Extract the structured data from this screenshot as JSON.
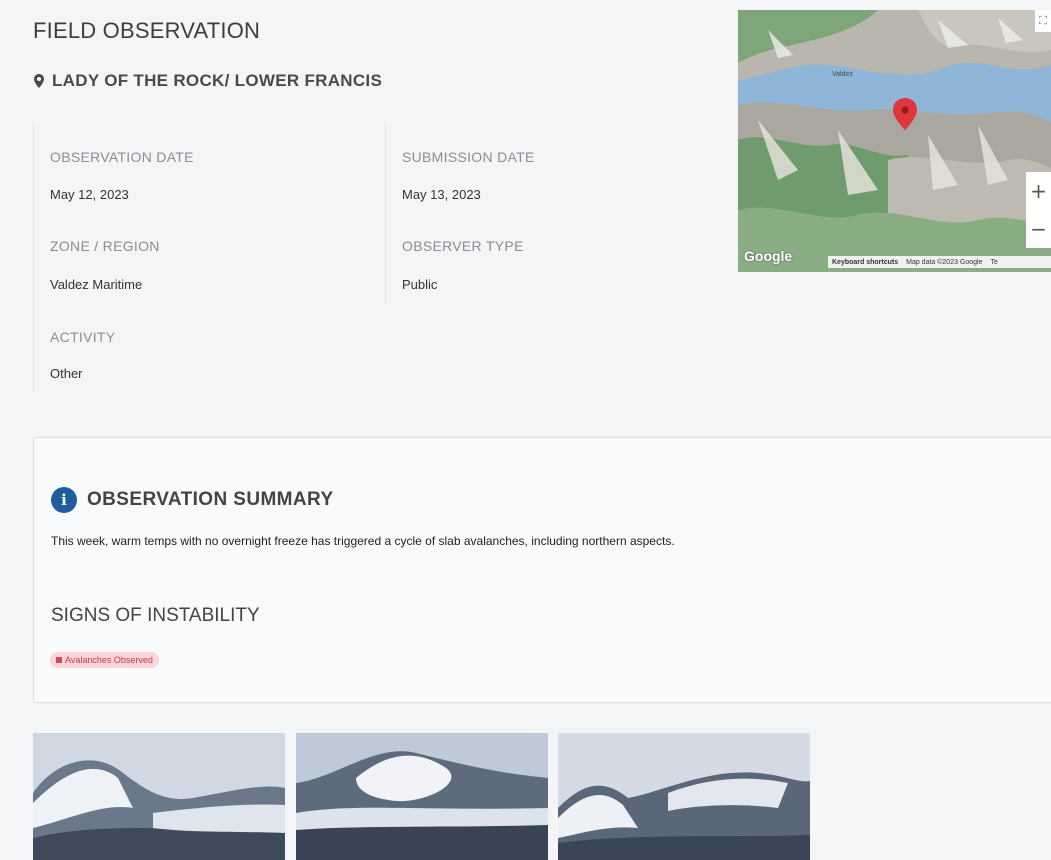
{
  "header": {
    "title": "FIELD OBSERVATION",
    "location": "LADY OF THE ROCK/ LOWER FRANCIS"
  },
  "details": {
    "observation_date": {
      "label": "OBSERVATION DATE",
      "value": "May 12, 2023"
    },
    "submission_date": {
      "label": "SUBMISSION DATE",
      "value": "May 13, 2023"
    },
    "zone": {
      "label": "ZONE / REGION",
      "value": "Valdez Maritime"
    },
    "observer_type": {
      "label": "OBSERVER TYPE",
      "value": "Public"
    },
    "activity": {
      "label": "ACTIVITY",
      "value": "Other"
    }
  },
  "map": {
    "place_label": "Valdez",
    "zoom_in": "+",
    "zoom_out": "−",
    "fullscreen": "⛶",
    "google_label": "Google",
    "keyboard_shortcuts": "Keyboard shortcuts",
    "map_data": "Map data ©2023 Google",
    "terms": "Te"
  },
  "summary": {
    "title": "OBSERVATION SUMMARY",
    "text": "This week, warm temps with no overnight freeze has triggered a cycle of slab avalanches, including northern aspects.",
    "signs_title": "SIGNS OF INSTABILITY",
    "badge": "Avalanches Observed"
  },
  "icons": {
    "location": "map-pin-icon",
    "info": "info-icon",
    "badge": "flag-icon"
  },
  "colors": {
    "info_blue": "#1e5e9e",
    "badge_bg": "#fbd5d9",
    "badge_text": "#c43a48",
    "map_marker": "#e0353a"
  }
}
